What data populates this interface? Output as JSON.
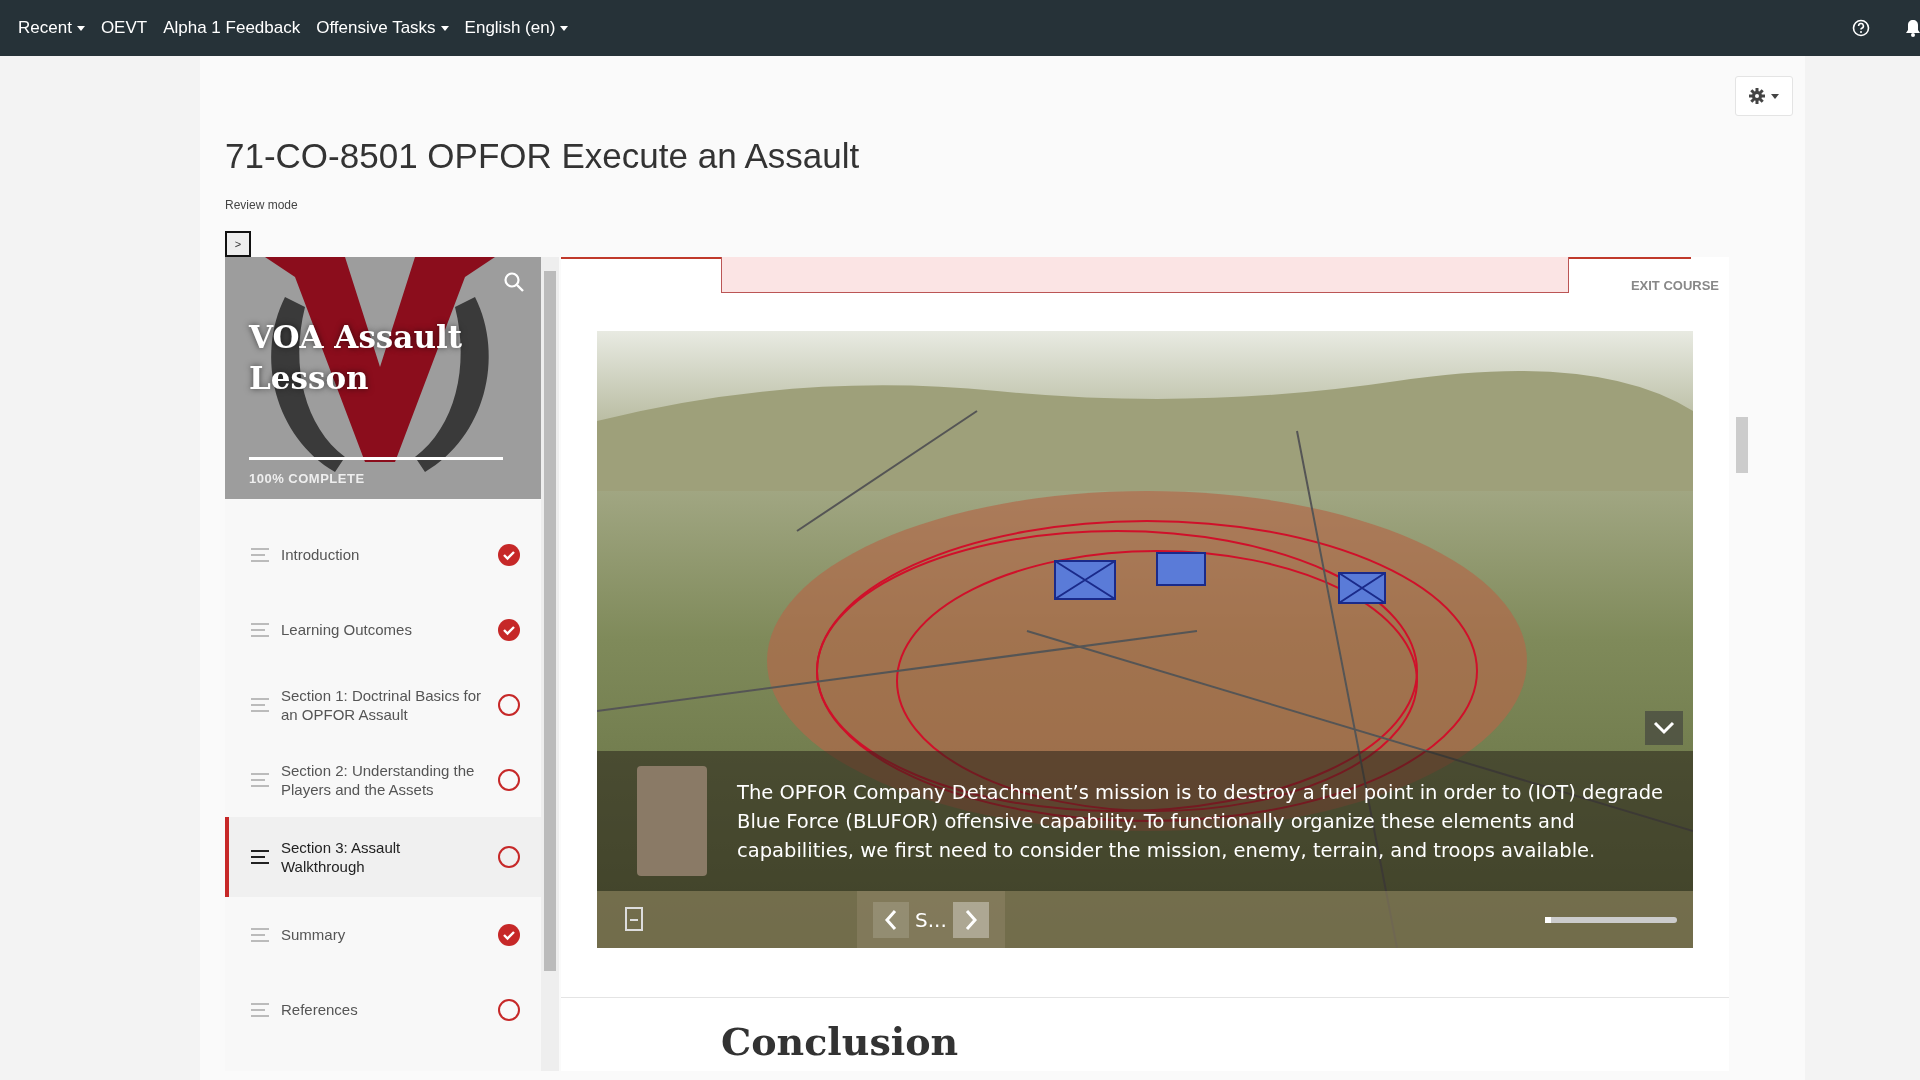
{
  "top_nav": {
    "items": [
      {
        "label": "Recent",
        "dropdown": true
      },
      {
        "label": "OEVT",
        "dropdown": false
      },
      {
        "label": "Alpha 1 Feedback",
        "dropdown": false
      },
      {
        "label": "Offensive Tasks",
        "dropdown": true
      },
      {
        "label": "English (en)",
        "dropdown": true
      }
    ]
  },
  "page": {
    "title": "71-CO-8501 OPFOR Execute an Assault",
    "mode": "Review mode",
    "toggle": ">"
  },
  "lesson": {
    "title": "VOA Assault Lesson",
    "progress_label": "100% COMPLETE",
    "level": 1,
    "items": [
      {
        "label": "Introduction",
        "completed": true,
        "selected": false
      },
      {
        "label": "Learning Outcomes",
        "completed": true,
        "selected": false
      },
      {
        "label": "Section 1: Doctrinal Basics for an OPFOR Assault",
        "completed": false,
        "selected": false
      },
      {
        "label": "Section 2: Understanding the Players and the Assets",
        "completed": false,
        "selected": false
      },
      {
        "label": "Section 3: Assault Walkthrough",
        "completed": false,
        "selected": true
      },
      {
        "label": "Summary",
        "completed": true,
        "selected": false
      },
      {
        "label": "References",
        "completed": false,
        "selected": false
      }
    ]
  },
  "content": {
    "exit": "EXIT COURSE",
    "caption": "The OPFOR Company Detachment’s mission is to destroy a fuel point in order to (IOT) degrade Blue Force (BLUFOR) offensive capability. To functionally organize these elements and capabilities, we first need to consider the mission, enemy, terrain, and troops available.",
    "slide_label": "S...",
    "level": 0.02,
    "heading": "Conclusion"
  }
}
